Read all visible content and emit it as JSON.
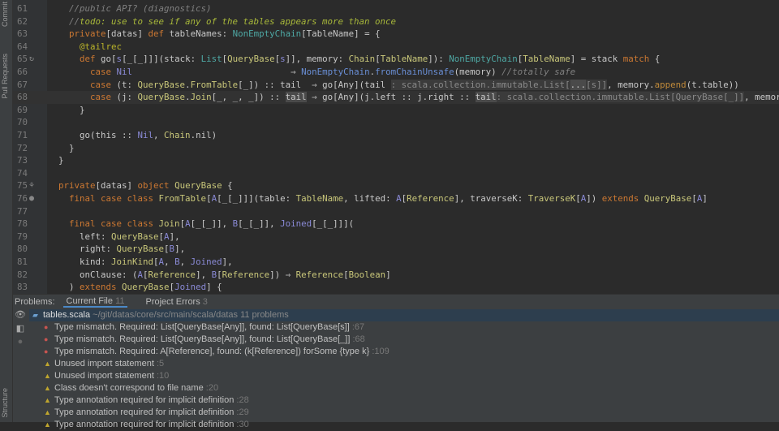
{
  "sidebar": {
    "commit": "Commit",
    "pull_requests": "Pull Requests",
    "structure": "Structure"
  },
  "editor": {
    "lines": [
      {
        "n": "61",
        "t": [
          [
            "    "
          ],
          [
            "//public API? (diagnostics)",
            "cm"
          ]
        ]
      },
      {
        "n": "62",
        "t": [
          [
            "    "
          ],
          [
            "//",
            "cm"
          ],
          [
            "todo: use to see if any of the tables appears more than once",
            "td"
          ]
        ]
      },
      {
        "n": "63",
        "t": [
          [
            "    "
          ],
          [
            "private",
            "k"
          ],
          [
            "[datas] "
          ],
          [
            "def",
            "k"
          ],
          [
            " tableNames: "
          ],
          [
            "NonEmptyChain",
            "tc"
          ],
          [
            "[TableName] = {"
          ]
        ]
      },
      {
        "n": "64",
        "t": [
          [
            "      "
          ],
          [
            "@tailrec",
            "an"
          ]
        ]
      },
      {
        "n": "65",
        "g": "↻",
        "t": [
          [
            "      "
          ],
          [
            "def",
            "k"
          ],
          [
            " go["
          ],
          [
            "s",
            "tp"
          ],
          [
            "[_[_]]](stack: "
          ],
          [
            "List",
            "tc"
          ],
          [
            "["
          ],
          [
            "QueryBase",
            "ty"
          ],
          [
            "["
          ],
          [
            "s",
            "tp"
          ],
          [
            "]], memory: "
          ],
          [
            "Chain",
            "ty"
          ],
          [
            "["
          ],
          [
            "TableName",
            "ty"
          ],
          [
            "]): "
          ],
          [
            "NonEmptyChain",
            "tc"
          ],
          [
            "["
          ],
          [
            "TableName",
            "ty"
          ],
          [
            "] = stack "
          ],
          [
            "match",
            "k"
          ],
          [
            " {"
          ]
        ]
      },
      {
        "n": "66",
        "t": [
          [
            "        "
          ],
          [
            "case",
            "k"
          ],
          [
            " "
          ],
          [
            "Nil",
            "tp"
          ],
          [
            "                              ⇒ "
          ],
          [
            "NonEmptyChain",
            "mt"
          ],
          [
            "."
          ],
          [
            "fromChainUnsafe",
            "mt"
          ],
          [
            "(memory) "
          ],
          [
            "//totally safe",
            "cm"
          ]
        ]
      },
      {
        "n": "67",
        "t": [
          [
            "        "
          ],
          [
            "case",
            "k"
          ],
          [
            " (t: "
          ],
          [
            "QueryBase",
            "ty"
          ],
          [
            "."
          ],
          [
            "FromTable",
            "ty"
          ],
          [
            "[_]) :: tail  ⇒ go[Any](tail "
          ],
          [
            ": scala.collection.immutable.List[",
            "hn"
          ],
          [
            "...",
            "hl"
          ],
          [
            "[s]]",
            "hn"
          ],
          [
            ", memory."
          ],
          [
            "append",
            "fn"
          ],
          [
            "(t.table))"
          ]
        ]
      },
      {
        "n": "68",
        "cur": true,
        "t": [
          [
            "        "
          ],
          [
            "case",
            "k"
          ],
          [
            " (j: "
          ],
          [
            "QueryBase",
            "ty"
          ],
          [
            "."
          ],
          [
            "Join",
            "ty"
          ],
          [
            "[_, _, _]) :: "
          ],
          [
            "tail",
            "hl"
          ],
          [
            " ⇒ go[Any](j.left :: j.right :: "
          ],
          [
            "tail",
            "hl"
          ],
          [
            ": scala.collection.immutable.List[QueryBase[_]]",
            "hn"
          ],
          [
            ", memory)"
          ]
        ]
      },
      {
        "n": "69",
        "t": [
          [
            "      }"
          ]
        ]
      },
      {
        "n": "70",
        "t": [
          [
            ""
          ]
        ]
      },
      {
        "n": "71",
        "t": [
          [
            "      go(this :: "
          ],
          [
            "Nil",
            "tp"
          ],
          [
            ", "
          ],
          [
            "Chain",
            "ty"
          ],
          [
            ".nil)"
          ]
        ]
      },
      {
        "n": "72",
        "t": [
          [
            "    }"
          ]
        ]
      },
      {
        "n": "73",
        "t": [
          [
            "  }"
          ]
        ]
      },
      {
        "n": "74",
        "t": [
          [
            ""
          ]
        ]
      },
      {
        "n": "75",
        "g": "⚘",
        "t": [
          [
            "  "
          ],
          [
            "private",
            "k"
          ],
          [
            "[datas] "
          ],
          [
            "object",
            "k"
          ],
          [
            " "
          ],
          [
            "QueryBase",
            "ty"
          ],
          [
            " {"
          ]
        ]
      },
      {
        "n": "76",
        "g": "●",
        "t": [
          [
            "    "
          ],
          [
            "final case class",
            "k"
          ],
          [
            " "
          ],
          [
            "FromTable",
            "ty"
          ],
          [
            "["
          ],
          [
            "A",
            "tp"
          ],
          [
            "[_[_]]](table: "
          ],
          [
            "TableName",
            "ty"
          ],
          [
            ", lifted: "
          ],
          [
            "A",
            "tp"
          ],
          [
            "["
          ],
          [
            "Reference",
            "ty"
          ],
          [
            "], traverseK: "
          ],
          [
            "TraverseK",
            "ty"
          ],
          [
            "["
          ],
          [
            "A",
            "tp"
          ],
          [
            "]) "
          ],
          [
            "extends",
            "k"
          ],
          [
            " "
          ],
          [
            "QueryBase",
            "ty"
          ],
          [
            "["
          ],
          [
            "A",
            "tp"
          ],
          [
            "]"
          ]
        ]
      },
      {
        "n": "77",
        "t": [
          [
            ""
          ]
        ]
      },
      {
        "n": "78",
        "t": [
          [
            "    "
          ],
          [
            "final case class",
            "k"
          ],
          [
            " "
          ],
          [
            "Join",
            "ty"
          ],
          [
            "["
          ],
          [
            "A",
            "tp"
          ],
          [
            "[_[_]], "
          ],
          [
            "B",
            "tp"
          ],
          [
            "[_[_]], "
          ],
          [
            "Joined",
            "tp"
          ],
          [
            "[_[_]]]("
          ]
        ]
      },
      {
        "n": "79",
        "t": [
          [
            "      left: "
          ],
          [
            "QueryBase",
            "ty"
          ],
          [
            "["
          ],
          [
            "A",
            "tp"
          ],
          [
            "],"
          ]
        ]
      },
      {
        "n": "80",
        "t": [
          [
            "      right: "
          ],
          [
            "QueryBase",
            "ty"
          ],
          [
            "["
          ],
          [
            "B",
            "tp"
          ],
          [
            "],"
          ]
        ]
      },
      {
        "n": "81",
        "t": [
          [
            "      kind: "
          ],
          [
            "JoinKind",
            "ty"
          ],
          [
            "["
          ],
          [
            "A",
            "tp"
          ],
          [
            ", "
          ],
          [
            "B",
            "tp"
          ],
          [
            ", "
          ],
          [
            "Joined",
            "tp"
          ],
          [
            "],"
          ]
        ]
      },
      {
        "n": "82",
        "t": [
          [
            "      onClause: ("
          ],
          [
            "A",
            "tp"
          ],
          [
            "["
          ],
          [
            "Reference",
            "ty"
          ],
          [
            "], "
          ],
          [
            "B",
            "tp"
          ],
          [
            "["
          ],
          [
            "Reference",
            "ty"
          ],
          [
            "]) ⇒ "
          ],
          [
            "Reference",
            "ty"
          ],
          [
            "["
          ],
          [
            "Boolean",
            "ty"
          ],
          [
            "]"
          ]
        ]
      },
      {
        "n": "83",
        "t": [
          [
            "    ) "
          ],
          [
            "extends",
            "k"
          ],
          [
            " "
          ],
          [
            "QueryBase",
            "ty"
          ],
          [
            "["
          ],
          [
            "Joined",
            "tp"
          ],
          [
            "] {"
          ]
        ]
      }
    ]
  },
  "problems": {
    "label": "Problems:",
    "tabs": [
      {
        "label": "Current File",
        "count": "11"
      },
      {
        "label": "Project Errors",
        "count": "3"
      }
    ],
    "file": {
      "name": "tables.scala",
      "path": "~/git/datas/core/src/main/scala/datas",
      "count": "11 problems"
    },
    "items": [
      {
        "sev": "error",
        "text": "Type mismatch. Required: List[QueryBase[Any]], found: List[QueryBase[s]]",
        "line": ":67"
      },
      {
        "sev": "error",
        "text": "Type mismatch. Required: List[QueryBase[Any]], found: List[QueryBase[_]]",
        "line": ":68"
      },
      {
        "sev": "error",
        "text": "Type mismatch. Required: A[Reference], found: (k[Reference]) forSome {type k}",
        "line": ":109"
      },
      {
        "sev": "warning",
        "text": "Unused import statement",
        "line": ":5"
      },
      {
        "sev": "warning",
        "text": "Unused import statement",
        "line": ":10"
      },
      {
        "sev": "warning",
        "text": "Class doesn't correspond to file name",
        "line": ":20"
      },
      {
        "sev": "warning",
        "text": "Type annotation required for implicit definition",
        "line": ":28"
      },
      {
        "sev": "warning",
        "text": "Type annotation required for implicit definition",
        "line": ":29"
      },
      {
        "sev": "warning",
        "text": "Type annotation required for implicit definition",
        "line": ":30"
      }
    ]
  },
  "colors": {
    "error": "#c75450",
    "warning": "#bfa62e",
    "accent": "#4a88c7"
  }
}
